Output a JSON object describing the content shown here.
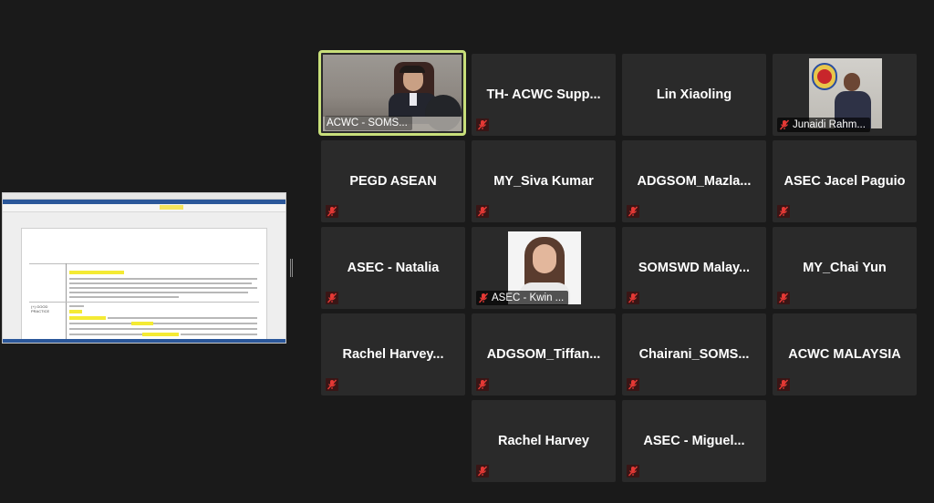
{
  "participants": [
    {
      "name": "ACWC - SOMS..."
    },
    {
      "name": "TH-  ACWC  Supp..."
    },
    {
      "name": "Lin Xiaoling"
    },
    {
      "name": "Junaidi Rahm..."
    },
    {
      "name": "PEGD ASEAN"
    },
    {
      "name": "MY_Siva Kumar"
    },
    {
      "name": "ADGSOM_Mazla..."
    },
    {
      "name": "ASEC Jacel Paguio"
    },
    {
      "name": "ASEC - Natalia"
    },
    {
      "name": "ASEC - Kwin ..."
    },
    {
      "name": "SOMSWD  Malay..."
    },
    {
      "name": "MY_Chai Yun"
    },
    {
      "name": "Rachel  Harvey..."
    },
    {
      "name": "ADGSOM_Tiffan..."
    },
    {
      "name": "Chairani_SOMS..."
    },
    {
      "name": "ACWC MALAYSIA"
    },
    {
      "name": "Rachel Harvey"
    },
    {
      "name": "ASEC  -  Miguel..."
    }
  ],
  "shared_doc": {
    "row2_label_a": "(+) GOOD",
    "row2_label_b": "PRACTICE"
  },
  "colors": {
    "active_speaker_border": "#c8df7a",
    "tile_bg": "#2a2a2a",
    "mute_icon": "#e53935"
  }
}
